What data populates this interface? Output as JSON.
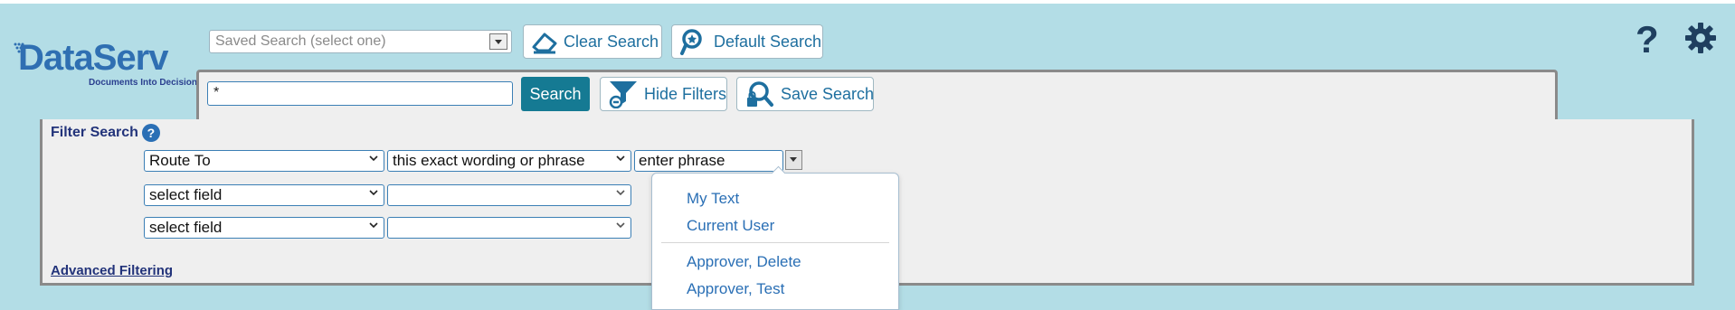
{
  "logo": {
    "name": "DataServ",
    "tagline": "Documents Into Decisions"
  },
  "toolbar": {
    "saved_search_placeholder": "Saved Search (select one)",
    "clear_search_label": "Clear Search",
    "default_search_label": "Default Search"
  },
  "search": {
    "query_value": "*",
    "search_label": "Search",
    "hide_filters_label": "Hide Filters",
    "save_search_label": "Save Search"
  },
  "filter": {
    "title": "Filter Search",
    "help_label": "?",
    "rows": [
      {
        "field": "Route To",
        "operator": "this exact wording or phrase",
        "value": "enter phrase"
      },
      {
        "field": "select field",
        "operator": ""
      },
      {
        "field": "select field",
        "operator": ""
      }
    ],
    "advanced_link": "Advanced Filtering"
  },
  "dropdown": {
    "items": [
      "My Text",
      "Current User",
      "Approver, Delete",
      "Approver, Test"
    ]
  },
  "header_icons": {
    "help": "?",
    "settings": "gear-icon"
  },
  "colors": {
    "background": "#b3dde6",
    "primary": "#157a93",
    "link": "#2a6fb5"
  }
}
